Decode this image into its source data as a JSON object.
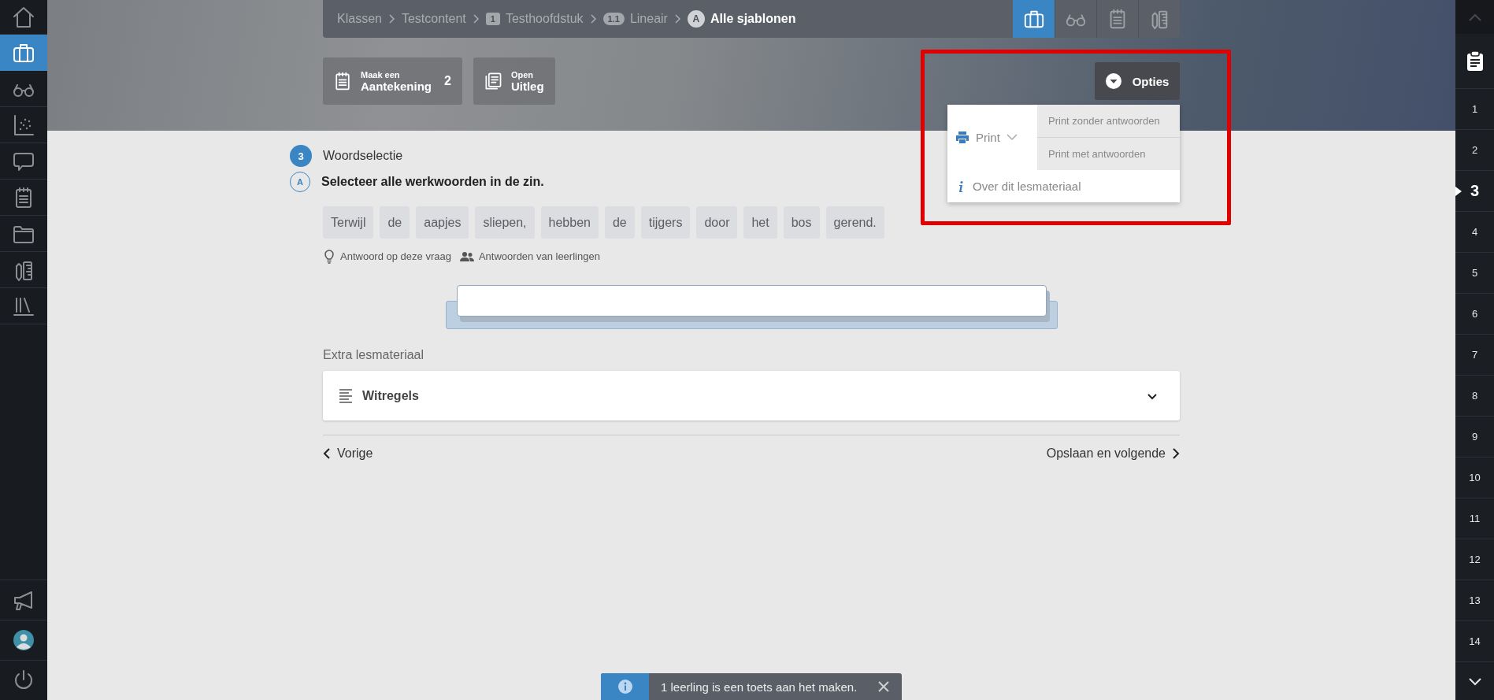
{
  "left_sidebar": {
    "items": [
      {
        "selected": false
      },
      {
        "selected": true
      },
      {
        "selected": false
      },
      {
        "selected": false
      },
      {
        "selected": false
      },
      {
        "selected": false
      },
      {
        "selected": false
      },
      {
        "selected": false
      },
      {
        "selected": false
      }
    ]
  },
  "breadcrumb": [
    {
      "kind": "plain",
      "label": "Klassen",
      "current": false
    },
    {
      "kind": "plain",
      "label": "Testcontent",
      "current": false
    },
    {
      "kind": "number",
      "badge": "1",
      "label": "Testhoofdstuk",
      "current": false
    },
    {
      "kind": "number",
      "badge": "1.1",
      "label": "Lineair",
      "current": false
    },
    {
      "kind": "letter",
      "badge": "A",
      "label": "Alle sjablonen",
      "current": true
    }
  ],
  "view_tabs": [
    {
      "selected": true
    },
    {
      "selected": false
    },
    {
      "selected": false
    },
    {
      "selected": false
    }
  ],
  "actions": [
    {
      "caption": "Maak een",
      "label": "Aantekening",
      "count": "2"
    },
    {
      "caption": "Open",
      "label": "Uitleg"
    }
  ],
  "options_button": {
    "label": "Opties"
  },
  "options_menu": {
    "print_label": "Print",
    "print_items": [
      "Print zonder antwoorden",
      "Print met antwoorden"
    ],
    "about": "Over dit lesmateriaal"
  },
  "question": {
    "number": "3",
    "title": "Woordselectie",
    "part": "A",
    "prompt": "Selecteer alle werkwoorden in de zin.",
    "words": [
      {
        "text": "Terwijl",
        "selected": false
      },
      {
        "text": "de",
        "selected": false
      },
      {
        "text": "aapjes",
        "selected": false
      },
      {
        "text": "sliepen,",
        "selected": false
      },
      {
        "text": "hebben",
        "selected": false
      },
      {
        "text": "de",
        "selected": false
      },
      {
        "text": "tijgers",
        "selected": false
      },
      {
        "text": "door",
        "selected": false
      },
      {
        "text": "het",
        "selected": false
      },
      {
        "text": "bos",
        "selected": false
      },
      {
        "text": "gerend.",
        "selected": false
      }
    ],
    "hints": [
      "Antwoord op deze vraag",
      "Antwoorden van leerlingen"
    ]
  },
  "extra": {
    "heading": "Extra lesmateriaal",
    "items": [
      {
        "title": "Witregels",
        "expanded": false
      }
    ]
  },
  "page_nav": {
    "previous": "Vorige",
    "next": "Opslaan en volgende"
  },
  "right_sidebar": {
    "pages": [
      {
        "label": "1",
        "selected": false
      },
      {
        "label": "2",
        "selected": false
      },
      {
        "label": "3",
        "selected": true
      },
      {
        "label": "4",
        "selected": false
      },
      {
        "label": "5",
        "selected": false
      },
      {
        "label": "6",
        "selected": false
      },
      {
        "label": "7",
        "selected": false
      },
      {
        "label": "8",
        "selected": false
      },
      {
        "label": "9",
        "selected": false
      },
      {
        "label": "10",
        "selected": false
      },
      {
        "label": "11",
        "selected": false
      },
      {
        "label": "12",
        "selected": false
      },
      {
        "label": "13",
        "selected": false
      },
      {
        "label": "14",
        "selected": false
      }
    ]
  },
  "toast": {
    "message": "1 leerling is een toets aan het maken."
  }
}
